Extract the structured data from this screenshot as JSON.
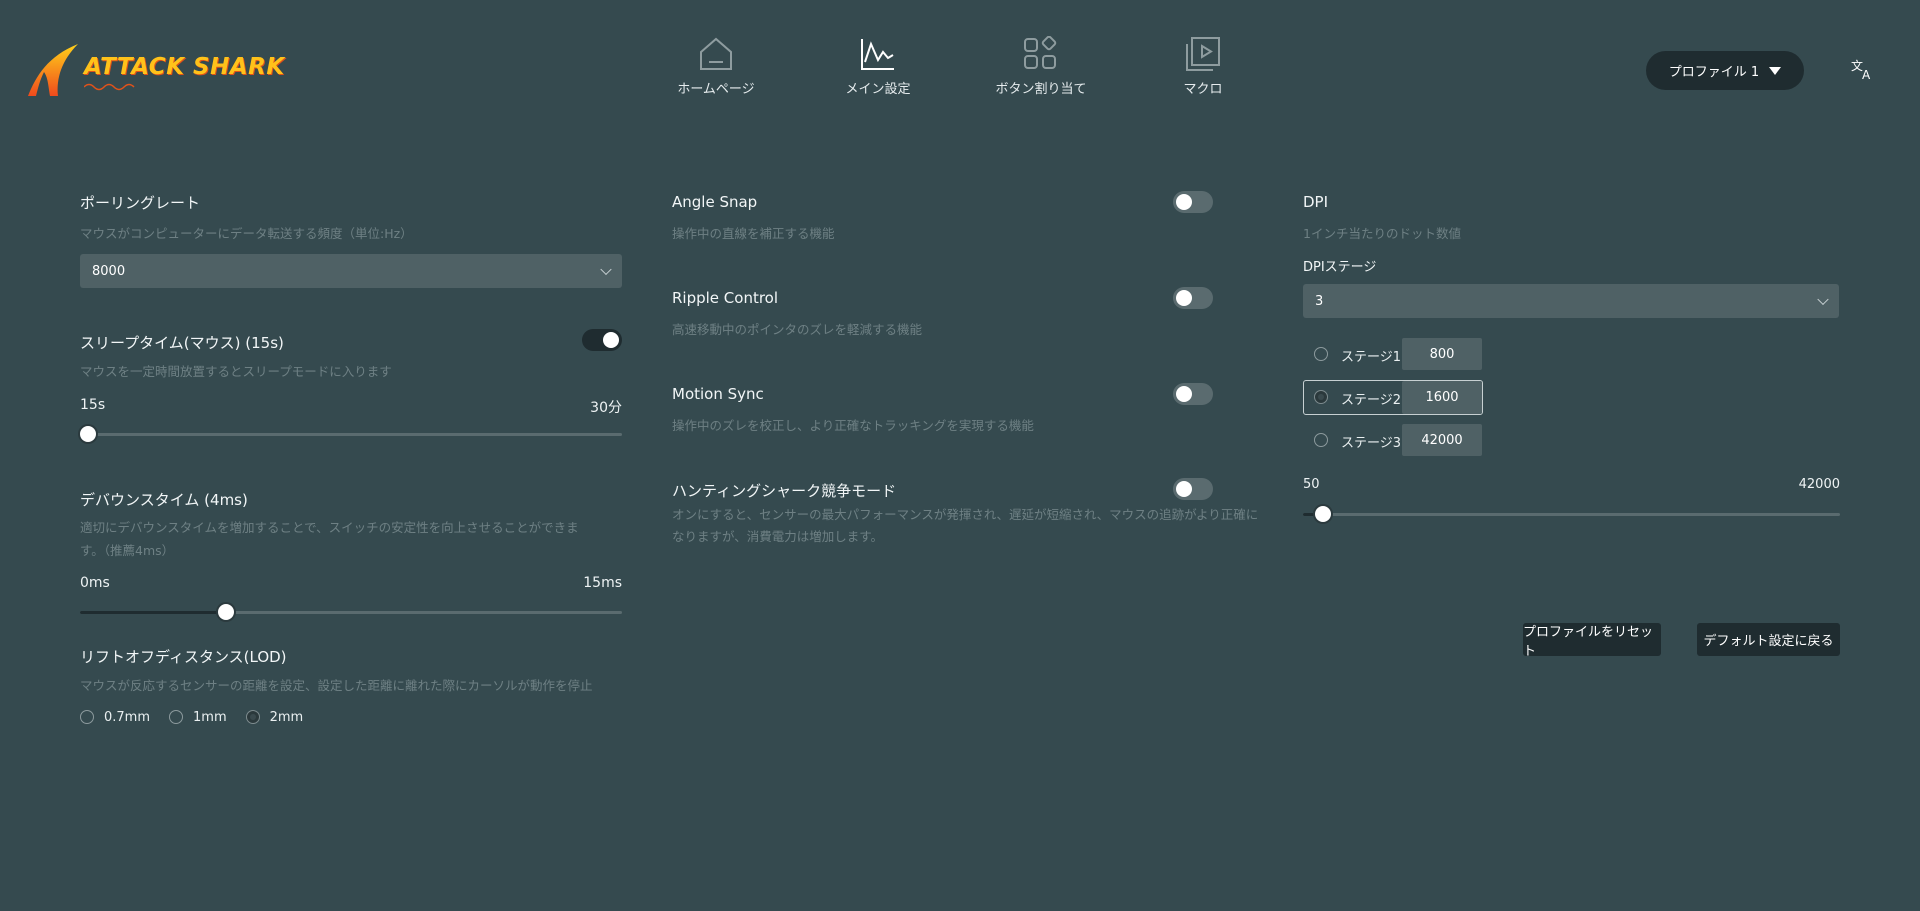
{
  "brand": {
    "logo_text": "ATTACK SHARK"
  },
  "nav": [
    {
      "label": "ホームページ",
      "icon": "home-icon",
      "active": false
    },
    {
      "label": "メイン設定",
      "icon": "chart-line-icon",
      "active": true
    },
    {
      "label": "ボタン割り当て",
      "icon": "grid-icon",
      "active": false
    },
    {
      "label": "マクロ",
      "icon": "macro-play-icon",
      "active": false
    }
  ],
  "header": {
    "profile_label": "プロファイル 1",
    "language_icon": "translate-icon"
  },
  "polling": {
    "title": "ポーリングレート",
    "desc": "マウスがコンピューターにデータ転送する頻度（単位:Hz）",
    "value": "8000"
  },
  "sleep": {
    "title": "スリープタイム(マウス) (15s)",
    "desc": "マウスを一定時間放置するとスリープモードに入ります",
    "min_label": "15s",
    "max_label": "30分",
    "enabled": true,
    "level": 0.0
  },
  "debounce": {
    "title": "デバウンスタイム (4ms)",
    "desc": "適切にデバウンスタイムを増加することで、スイッチの安定性を向上させることができます。（推薦4ms）",
    "min_label": "0ms",
    "max_label": "15ms",
    "level": 0.27
  },
  "lod": {
    "title": "リフトオフディスタンス(LOD)",
    "desc": "マウスが反応するセンサーの距離を設定、設定した距離に離れた際にカーソルが動作を停止",
    "options": [
      "0.7mm",
      "1mm",
      "2mm"
    ],
    "selected": "2mm"
  },
  "angle_snap": {
    "title": "Angle Snap",
    "desc": "操作中の直線を補正する機能",
    "enabled": false
  },
  "ripple": {
    "title": "Ripple Control",
    "desc": "高速移動中のポインタのズレを軽減する機能",
    "enabled": false
  },
  "motion_sync": {
    "title": "Motion Sync",
    "desc": "操作中のズレを校正し、より正確なトラッキングを実現する機能",
    "enabled": false
  },
  "hunting": {
    "title": "ハンティングシャーク競争モード",
    "desc_line1": "オンにすると、センサーの最大パフォーマンスが発揮され、遅延が短縮され、マウスの追跡がより正確に",
    "desc_line2": "なりますが、消費電力は増加します。",
    "enabled": false
  },
  "dpi": {
    "title": "DPI",
    "desc": "1インチ当たりのドット数値",
    "stage_label": "DPIステージ",
    "stage_count": "3",
    "stages": [
      {
        "label": "ステージ1",
        "value": "800"
      },
      {
        "label": "ステージ2",
        "value": "1600"
      },
      {
        "label": "ステージ3",
        "value": "42000"
      }
    ],
    "selected_stage": 2,
    "min_label": "50",
    "max_label": "42000",
    "level": 0.037
  },
  "actions": {
    "reset_profile": "プロファイルをリセット",
    "restore_default": "デフォルト設定に戻る"
  }
}
